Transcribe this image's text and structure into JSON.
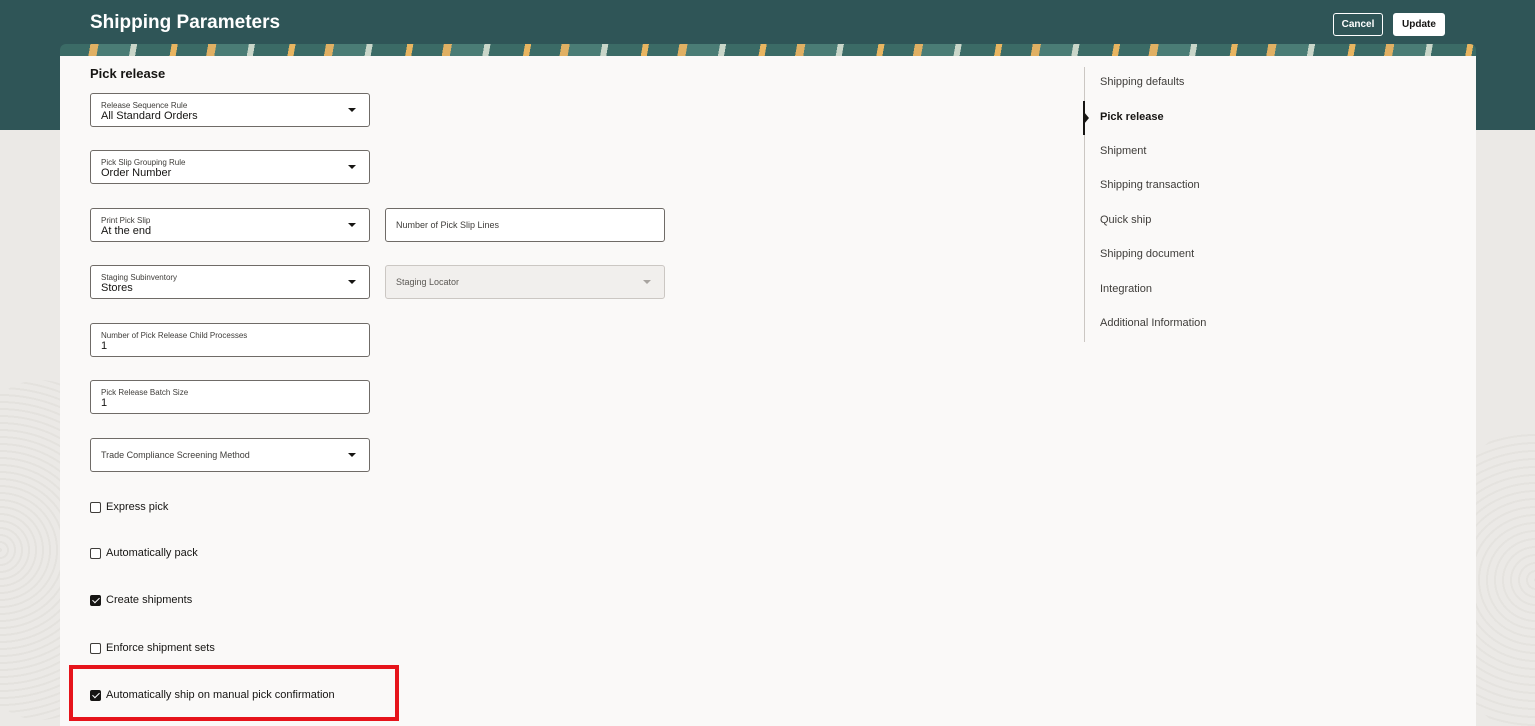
{
  "header": {
    "title": "Shipping Parameters",
    "cancel_label": "Cancel",
    "update_label": "Update"
  },
  "section": {
    "title": "Pick release"
  },
  "fields": {
    "release_sequence_rule": {
      "label": "Release Sequence Rule",
      "value": "All Standard Orders"
    },
    "pick_slip_grouping_rule": {
      "label": "Pick Slip Grouping Rule",
      "value": "Order Number"
    },
    "print_pick_slip": {
      "label": "Print Pick Slip",
      "value": "At the end"
    },
    "number_of_pick_slip_lines": {
      "placeholder": "Number of Pick Slip Lines",
      "value": ""
    },
    "staging_subinventory": {
      "label": "Staging Subinventory",
      "value": "Stores"
    },
    "staging_locator": {
      "placeholder": "Staging Locator",
      "value": ""
    },
    "child_processes": {
      "label": "Number of Pick Release Child Processes",
      "value": "1"
    },
    "batch_size": {
      "label": "Pick Release Batch Size",
      "value": "1"
    },
    "trade_compliance": {
      "placeholder": "Trade Compliance Screening Method",
      "value": ""
    }
  },
  "checkboxes": [
    {
      "label": "Express pick",
      "checked": false
    },
    {
      "label": "Automatically pack",
      "checked": false
    },
    {
      "label": "Create shipments",
      "checked": true
    },
    {
      "label": "Enforce shipment sets",
      "checked": false
    },
    {
      "label": "Automatically ship on manual pick confirmation",
      "checked": true
    }
  ],
  "nav": {
    "items": [
      {
        "label": "Shipping defaults"
      },
      {
        "label": "Pick release",
        "active": true
      },
      {
        "label": "Shipment"
      },
      {
        "label": "Shipping transaction"
      },
      {
        "label": "Quick ship"
      },
      {
        "label": "Shipping document"
      },
      {
        "label": "Integration"
      },
      {
        "label": "Additional Information"
      }
    ]
  },
  "colors": {
    "header_bg": "#2f5557",
    "highlight": "#e6141b"
  },
  "icons": {
    "dropdown": "caret-down-icon",
    "checkbox_checked": "checkmark-icon",
    "nav_current": "triangle-right-icon"
  }
}
